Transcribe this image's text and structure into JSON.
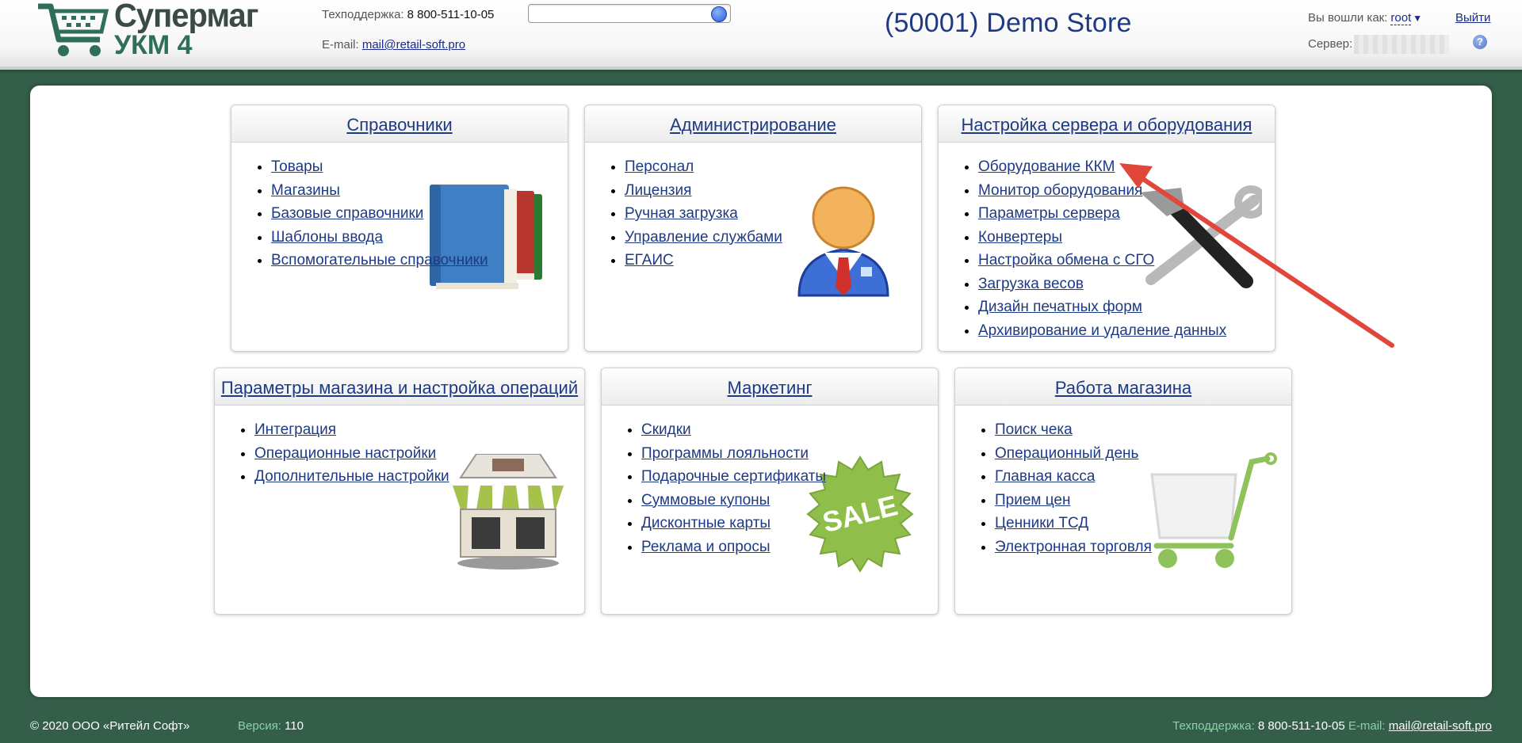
{
  "brand": {
    "line1": "Супермаг",
    "line2": "УКМ 4"
  },
  "header": {
    "support_label": "Техподдержка:",
    "support_phone": "8 800-511-10-05",
    "email_label": "E-mail:",
    "email": "mail@retail-soft.pro",
    "search_placeholder": "",
    "store_title": "(50001) Demo Store",
    "logged_label": "Вы вошли как:",
    "user": "root",
    "logout": "Выйти",
    "server_label": "Сервер:",
    "help": "?"
  },
  "cards": [
    {
      "title": "Справочники",
      "icon": "books-icon",
      "items": [
        "Товары",
        "Магазины",
        "Базовые справочники",
        "Шаблоны ввода",
        "Вспомогательные справочники"
      ]
    },
    {
      "title": "Администрирование",
      "icon": "user-icon",
      "items": [
        "Персонал",
        "Лицензия",
        "Ручная загрузка",
        "Управление службами",
        "ЕГАИС"
      ]
    },
    {
      "title": "Настройка сервера и оборудования",
      "icon": "tools-icon",
      "items": [
        "Оборудование ККМ",
        "Монитор оборудования",
        "Параметры сервера",
        "Конвертеры",
        "Настройка обмена с СГО",
        "Загрузка весов",
        "Дизайн печатных форм",
        "Архивирование и удаление данных"
      ]
    },
    {
      "title": "Параметры магазина и настройка операций",
      "icon": "store-icon",
      "items": [
        "Интеграция",
        "Операционные настройки",
        "Дополнительные настройки"
      ]
    },
    {
      "title": "Маркетинг",
      "icon": "sale-badge-icon",
      "badge": "SALE",
      "items": [
        "Скидки",
        "Программы лояльности",
        "Подарочные сертификаты",
        "Суммовые купоны",
        "Дисконтные карты",
        "Реклама и опросы"
      ]
    },
    {
      "title": "Работа магазина",
      "icon": "cart-icon",
      "items": [
        "Поиск чека",
        "Операционный день",
        "Главная касса",
        "Прием цен",
        "Ценники ТСД",
        "Электронная торговля"
      ]
    }
  ],
  "footer": {
    "copyright": "© 2020 ООО «Ритейл Софт»",
    "version_label": "Версия:",
    "version": "110",
    "support_label": "Техподдержка:",
    "support_phone": "8 800-511-10-05",
    "email_label": "E-mail:",
    "email": "mail@retail-soft.pro"
  },
  "colors": {
    "background": "#345e4a",
    "link": "#1e3a84",
    "arrow": "#e0473a"
  }
}
